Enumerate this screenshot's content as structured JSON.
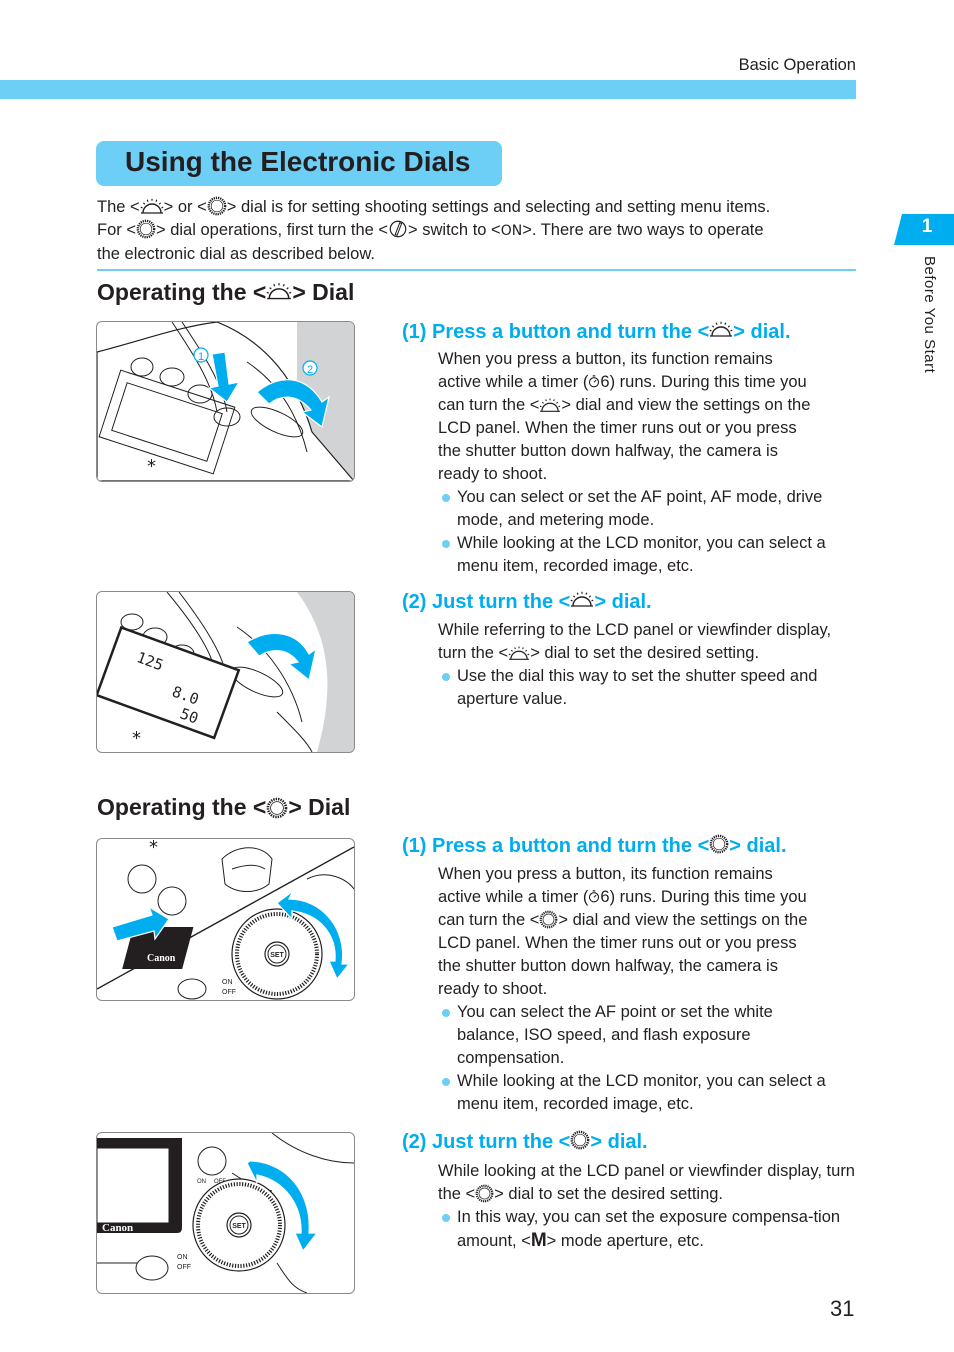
{
  "header": {
    "section_label": "Basic Operation"
  },
  "title": "Using the Electronic Dials",
  "intro": {
    "line1_a": "The <",
    "line1_b": "> or <",
    "line1_c": "> dial is for setting shooting settings and selecting and setting menu items.",
    "line2_a": "For <",
    "line2_b": "> dial operations, first turn the <",
    "line2_c": "> switch to <",
    "line2_on": "ON",
    "line2_d": ">. There are two ways to operate",
    "line3": "the electronic dial as described below."
  },
  "chapter": {
    "number": "1",
    "label": "Before You Start"
  },
  "icons": {
    "main_dial": "main-dial-icon",
    "quick_control_dial": "quick-control-dial-icon",
    "power_switch": "quick-control-switch-icon",
    "timer": "timer-icon",
    "manual_mode": "M"
  },
  "section_main": {
    "heading_a": "Operating the <",
    "heading_b": "> Dial",
    "step1": {
      "heading_a": "(1) Press a button and turn the <",
      "heading_b": "> dial.",
      "p_lines": [
        "When you press a button, its function remains",
        "active while a timer (",
        "6) runs. During this time you",
        "can turn the <",
        "> dial and view the settings on the",
        "LCD panel. When the timer runs out or you press",
        "the shutter button down halfway, the camera is",
        "ready to shoot."
      ],
      "bullets": [
        "You can select or set the AF point, AF mode, drive mode, and metering mode.",
        "While looking at the LCD monitor, you can select a menu item, recorded image, etc."
      ],
      "illustration_labels": [
        "1",
        "2"
      ]
    },
    "step2": {
      "heading_a": "(2) Just turn the <",
      "heading_b": "> dial.",
      "p_a": "While referring to the LCD panel or viewfinder display, turn the <",
      "p_b": "> dial to set the desired setting.",
      "bullets": [
        "Use the dial this way to set the shutter speed and aperture value."
      ],
      "lcd_values": [
        "125",
        "8.0",
        "50"
      ]
    }
  },
  "section_qcd": {
    "heading_a": "Operating the <",
    "heading_b": "> Dial",
    "step1": {
      "heading_a": "(1) Press a button and turn the <",
      "heading_b": "> dial.",
      "p_lines": [
        "When you press a button, its function remains",
        "active while a timer (",
        "6) runs. During this time you",
        "can turn the <",
        "> dial and view the settings on the",
        "LCD panel. When the timer runs out or you press",
        "the shutter button down halfway, the camera is",
        "ready to shoot."
      ],
      "bullets": [
        "You can select the AF point or set the white balance, ISO speed, and flash exposure compensation.",
        "While looking at the LCD monitor, you can select a menu item, recorded image, etc."
      ],
      "illustration_labels": {
        "set": "SET",
        "on": "ON",
        "off": "OFF",
        "brand": "Canon"
      }
    },
    "step2": {
      "heading_a": "(2) Just turn the <",
      "heading_b": "> dial.",
      "p_a": "While looking at the LCD panel or viewfinder display, turn the <",
      "p_b": "> dial to set the desired setting.",
      "bullet_a": "In this way, you can set the exposure compensa-tion amount, <",
      "bullet_b": "> mode aperture, etc.",
      "illustration_labels": {
        "set": "SET",
        "on": "ON",
        "off": "OFF",
        "brand": "Canon"
      }
    }
  },
  "page_number": "31",
  "colors": {
    "accent": "#6dcff6",
    "heading_blue": "#00aeef",
    "text": "#231f20"
  }
}
